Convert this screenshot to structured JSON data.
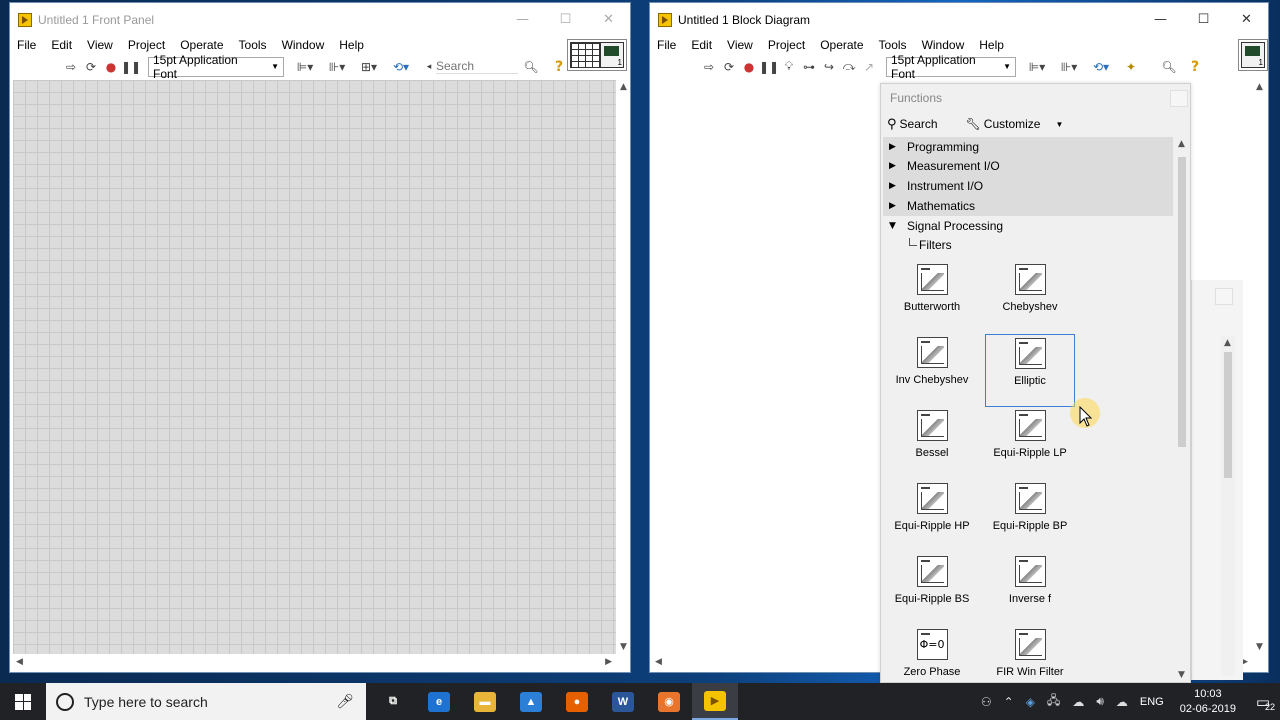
{
  "front_panel": {
    "title": "Untitled 1 Front Panel",
    "menu": [
      "File",
      "Edit",
      "View",
      "Project",
      "Operate",
      "Tools",
      "Window",
      "Help"
    ],
    "font": "15pt Application Font",
    "search_placeholder": "Search"
  },
  "block_diagram": {
    "title": "Untitled 1 Block Diagram",
    "menu": [
      "File",
      "Edit",
      "View",
      "Project",
      "Operate",
      "Tools",
      "Window",
      "Help"
    ],
    "font": "15pt Application Font"
  },
  "functions_palette": {
    "title": "Functions",
    "search_label": "Search",
    "customize_label": "Customize",
    "categories": [
      {
        "label": "Programming",
        "expanded": false
      },
      {
        "label": "Measurement I/O",
        "expanded": false
      },
      {
        "label": "Instrument I/O",
        "expanded": false
      },
      {
        "label": "Mathematics",
        "expanded": false
      },
      {
        "label": "Signal Processing",
        "expanded": true
      }
    ],
    "subpalette": "Filters",
    "items": [
      {
        "label": "Butterworth",
        "glyph": ""
      },
      {
        "label": "Chebyshev",
        "glyph": ""
      },
      {
        "label": "Inv Chebyshev",
        "glyph": ""
      },
      {
        "label": "Elliptic",
        "glyph": "",
        "selected": true
      },
      {
        "label": "Bessel",
        "glyph": ""
      },
      {
        "label": "Equi-Ripple LP",
        "glyph": ""
      },
      {
        "label": "Equi-Ripple HP",
        "glyph": ""
      },
      {
        "label": "Equi-Ripple BP",
        "glyph": ""
      },
      {
        "label": "Equi-Ripple BS",
        "glyph": ""
      },
      {
        "label": "Inverse f",
        "glyph": ""
      },
      {
        "label": "Zero Phase",
        "glyph": "Φ=0"
      },
      {
        "label": "FIR Win Filter",
        "glyph": ""
      }
    ]
  },
  "taskbar": {
    "search_placeholder": "Type here to search",
    "language": "ENG",
    "time": "10:03",
    "date": "02-06-2019",
    "notifications": "22",
    "apps": [
      {
        "name": "task-view",
        "color": "#202226",
        "text": "⧉"
      },
      {
        "name": "edge",
        "color": "#1e73d2",
        "text": "e"
      },
      {
        "name": "file-explorer",
        "color": "#e8b53a",
        "text": "▬"
      },
      {
        "name": "app-blue",
        "color": "#2b7fd6",
        "text": "▲"
      },
      {
        "name": "firefox",
        "color": "#e66000",
        "text": "●"
      },
      {
        "name": "word",
        "color": "#2b579a",
        "text": "W"
      },
      {
        "name": "app-orange",
        "color": "#e8752b",
        "text": "◉"
      },
      {
        "name": "labview",
        "color": "#f5c400",
        "text": "▶"
      }
    ]
  }
}
